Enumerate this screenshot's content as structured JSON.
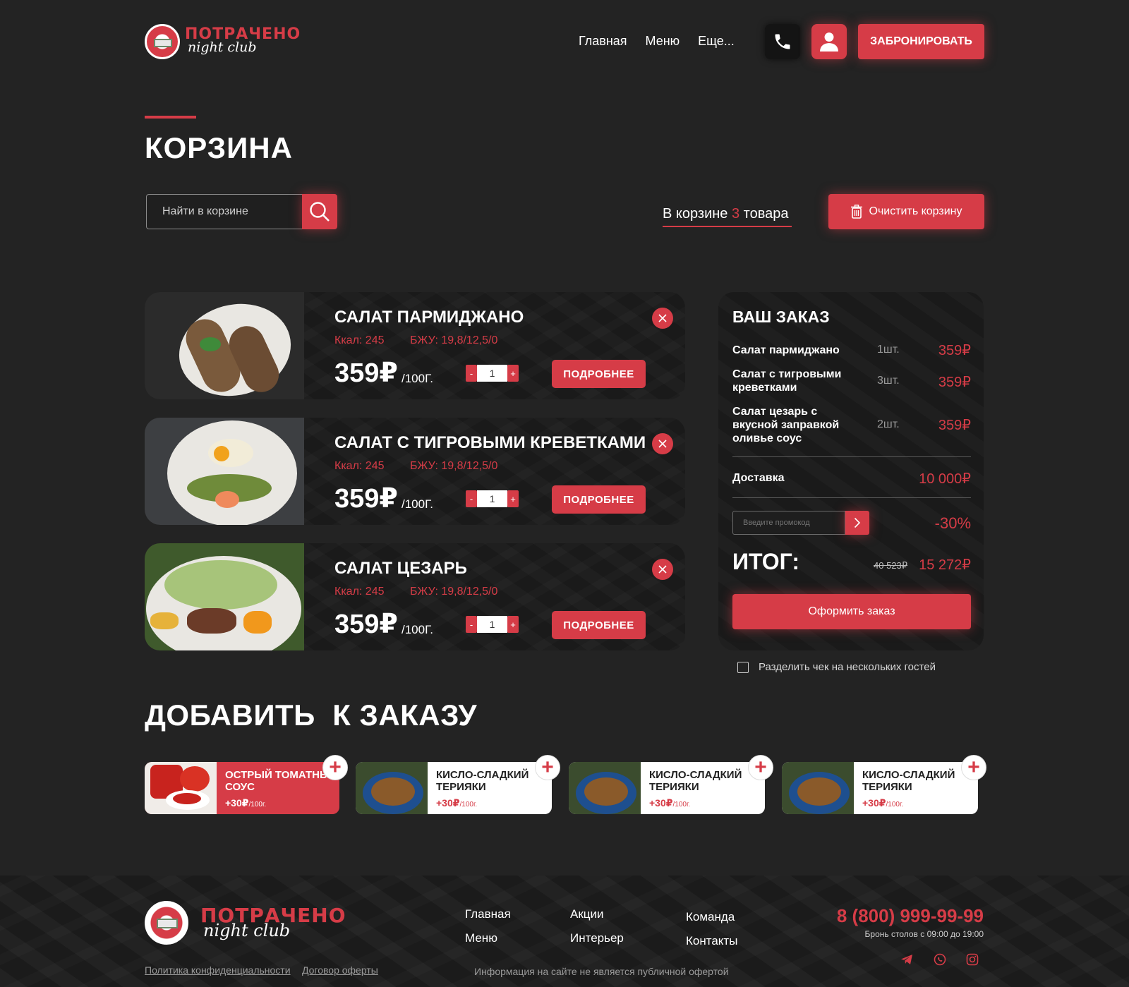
{
  "header": {
    "logo_title": "ПОТРАЧЕНО",
    "logo_sub": "night club",
    "nav": [
      "Главная",
      "Меню",
      "Еще..."
    ],
    "book_label": "ЗАБРОНИРОВАТЬ"
  },
  "page_title": "КОРЗИНА",
  "search": {
    "placeholder": "Найти в корзине"
  },
  "cart_count": {
    "prefix": "В корзине",
    "count": "3",
    "suffix": "товара"
  },
  "clear_label": "Очистить корзину",
  "products": [
    {
      "name": "САЛАТ ПАРМИДЖАНО",
      "kcal": "Ккал: 245",
      "bju": "БЖУ: 19,8/12,5/0",
      "price": "359₽",
      "unit": "/100Г.",
      "qty": "1",
      "more": "ПОДРОБНЕЕ"
    },
    {
      "name": "САЛАТ С ТИГРОВЫМИ КРЕВЕТКАМИ",
      "kcal": "Ккал: 245",
      "bju": "БЖУ: 19,8/12,5/0",
      "price": "359₽",
      "unit": "/100Г.",
      "qty": "1",
      "more": "ПОДРОБНЕЕ"
    },
    {
      "name": "САЛАТ ЦЕЗАРЬ",
      "kcal": "Ккал: 245",
      "bju": "БЖУ: 19,8/12,5/0",
      "price": "359₽",
      "unit": "/100Г.",
      "qty": "1",
      "more": "ПОДРОБНЕЕ"
    }
  ],
  "qty_minus": "-",
  "qty_plus": "+",
  "order": {
    "title": "ВАШ ЗАКАЗ",
    "items": [
      {
        "name": "Салат пармиджано",
        "qty": "1шт.",
        "price": "359₽"
      },
      {
        "name": "Салат с тигровыми креветками",
        "qty": "3шт.",
        "price": "359₽"
      },
      {
        "name": "Салат цезарь с вкусной заправкой оливье соус",
        "qty": "2шт.",
        "price": "359₽"
      }
    ],
    "delivery_label": "Доставка",
    "delivery_price": "10 000₽",
    "promo_placeholder": "Введите промокод",
    "discount": "-30%",
    "total_label": "ИТОГ:",
    "old_total": "40 523₽",
    "total": "15 272₽",
    "checkout_label": "Оформить заказ",
    "split_label": "Разделить чек на нескольких гостей"
  },
  "add_title": "ДОБАВИТЬ  К ЗАКАЗУ",
  "addons": [
    {
      "name": "ОСТРЫЙ ТОМАТНЫЙ СОУС",
      "price": "+30₽",
      "unit": "/100г."
    },
    {
      "name": "КИСЛО-СЛАДКИЙ ТЕРИЯКИ",
      "price": "+30₽",
      "unit": "/100г."
    },
    {
      "name": "КИСЛО-СЛАДКИЙ ТЕРИЯКИ",
      "price": "+30₽",
      "unit": "/100г."
    },
    {
      "name": "КИСЛО-СЛАДКИЙ ТЕРИЯКИ",
      "price": "+30₽",
      "unit": "/100г."
    }
  ],
  "footer": {
    "logo_title": "ПОТРАЧЕНО",
    "logo_sub": "night club",
    "links_col1": [
      "Главная",
      "Меню"
    ],
    "links_col2": [
      "Акции",
      "Интерьер"
    ],
    "links_col3": [
      "Команда",
      "Контакты"
    ],
    "phone": "8 (800) 999-99-99",
    "hours": "Бронь столов с 09:00 до 19:00",
    "privacy": "Политика конфиденциальности",
    "offer": "Договор оферты",
    "disclaimer": "Информация на сайте не является публичной офертой"
  },
  "colors": {
    "accent": "#d63c47",
    "background": "#232323",
    "card": "#1a1a1a"
  },
  "icons": [
    "phone-icon",
    "user-icon",
    "search-icon",
    "trash-icon",
    "close-icon",
    "arrow-right-icon",
    "plus-icon",
    "telegram-icon",
    "whatsapp-icon",
    "instagram-icon"
  ]
}
